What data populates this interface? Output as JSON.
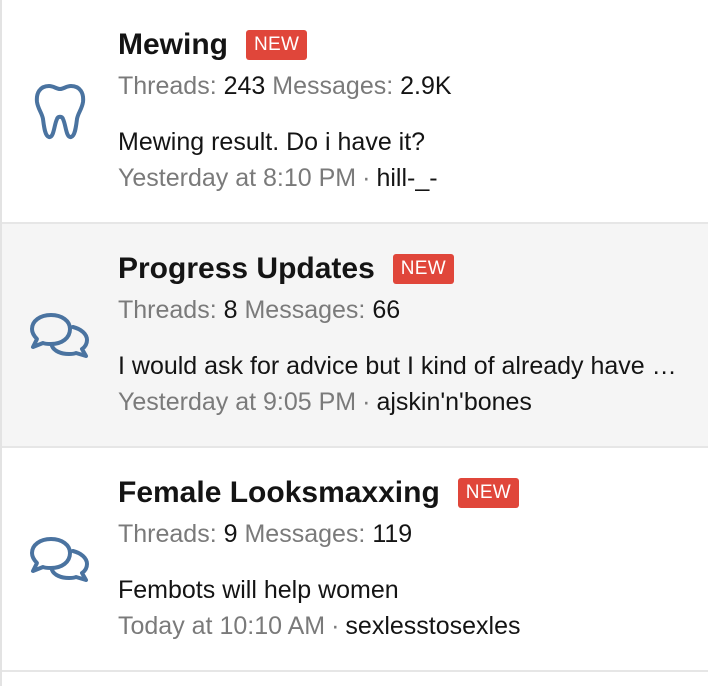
{
  "forums": [
    {
      "icon": "tooth-icon",
      "title": "Mewing",
      "badge": "NEW",
      "threads_label": "Threads:",
      "threads": "243",
      "messages_label": "Messages:",
      "messages": "2.9K",
      "latest_title": "Mewing result. Do i have it?",
      "latest_date": "Yesterday at 8:10 PM",
      "separator": "·",
      "latest_user": "hill-_-"
    },
    {
      "icon": "speech-bubbles-icon",
      "title": "Progress Updates",
      "badge": "NEW",
      "threads_label": "Threads:",
      "threads": "8",
      "messages_label": "Messages:",
      "messages": "66",
      "latest_title": "I would ask for advice but I kind of already have an idea what to do",
      "latest_date": "Yesterday at 9:05 PM",
      "separator": "·",
      "latest_user": "ajskin'n'bones"
    },
    {
      "icon": "speech-bubbles-icon",
      "title": "Female Looksmaxxing",
      "badge": "NEW",
      "threads_label": "Threads:",
      "threads": "9",
      "messages_label": "Messages:",
      "messages": "119",
      "latest_title": "Fembots will help women",
      "latest_date": "Today at 10:10 AM",
      "separator": "·",
      "latest_user": "sexlesstosexles"
    }
  ],
  "colors": {
    "icon": "#4a73a0",
    "badge": "#e0463a",
    "muted": "#7a7a7a",
    "alt_row": "#f5f5f5"
  }
}
